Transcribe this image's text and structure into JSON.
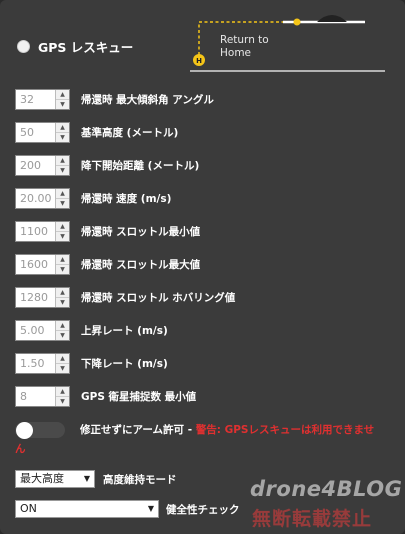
{
  "gps_rescue": {
    "label": "GPS レスキュー"
  },
  "diagram": {
    "caption_line1": "Return to",
    "caption_line2": "Home",
    "home_marker": "H"
  },
  "settings": [
    {
      "value": "32",
      "label": "帰還時 最大傾斜角 アングル"
    },
    {
      "value": "50",
      "label": "基準高度 (メートル)"
    },
    {
      "value": "200",
      "label": "降下開始距離 (メートル)"
    },
    {
      "value": "20.00",
      "label": "帰還時 速度 (m/s)"
    },
    {
      "value": "1100",
      "label": "帰還時 スロットル最小値"
    },
    {
      "value": "1600",
      "label": "帰還時 スロットル最大値"
    },
    {
      "value": "1280",
      "label": "帰還時 スロットル ホバリング値"
    },
    {
      "value": "5.00",
      "label": "上昇レート (m/s)"
    },
    {
      "value": "1.50",
      "label": "下降レート (m/s)"
    },
    {
      "value": "8",
      "label": "GPS 衛星捕捉数 最小値"
    }
  ],
  "arm_toggle": {
    "label": "修正せずにアーム許可 - ",
    "warning": "警告: GPSレスキューは利用できませ",
    "warning_cont": "ん"
  },
  "altitude_mode": {
    "selected": "最大高度",
    "label": "高度維持モード"
  },
  "sanity_check": {
    "selected": "ON",
    "label": "健全性チェック"
  },
  "watermark": {
    "line1": "drone4BLOG",
    "line2": "無断転載禁止"
  },
  "colors": {
    "panel": "#3b3b3b",
    "accent": "#f5c518",
    "warning": "#e03030"
  }
}
